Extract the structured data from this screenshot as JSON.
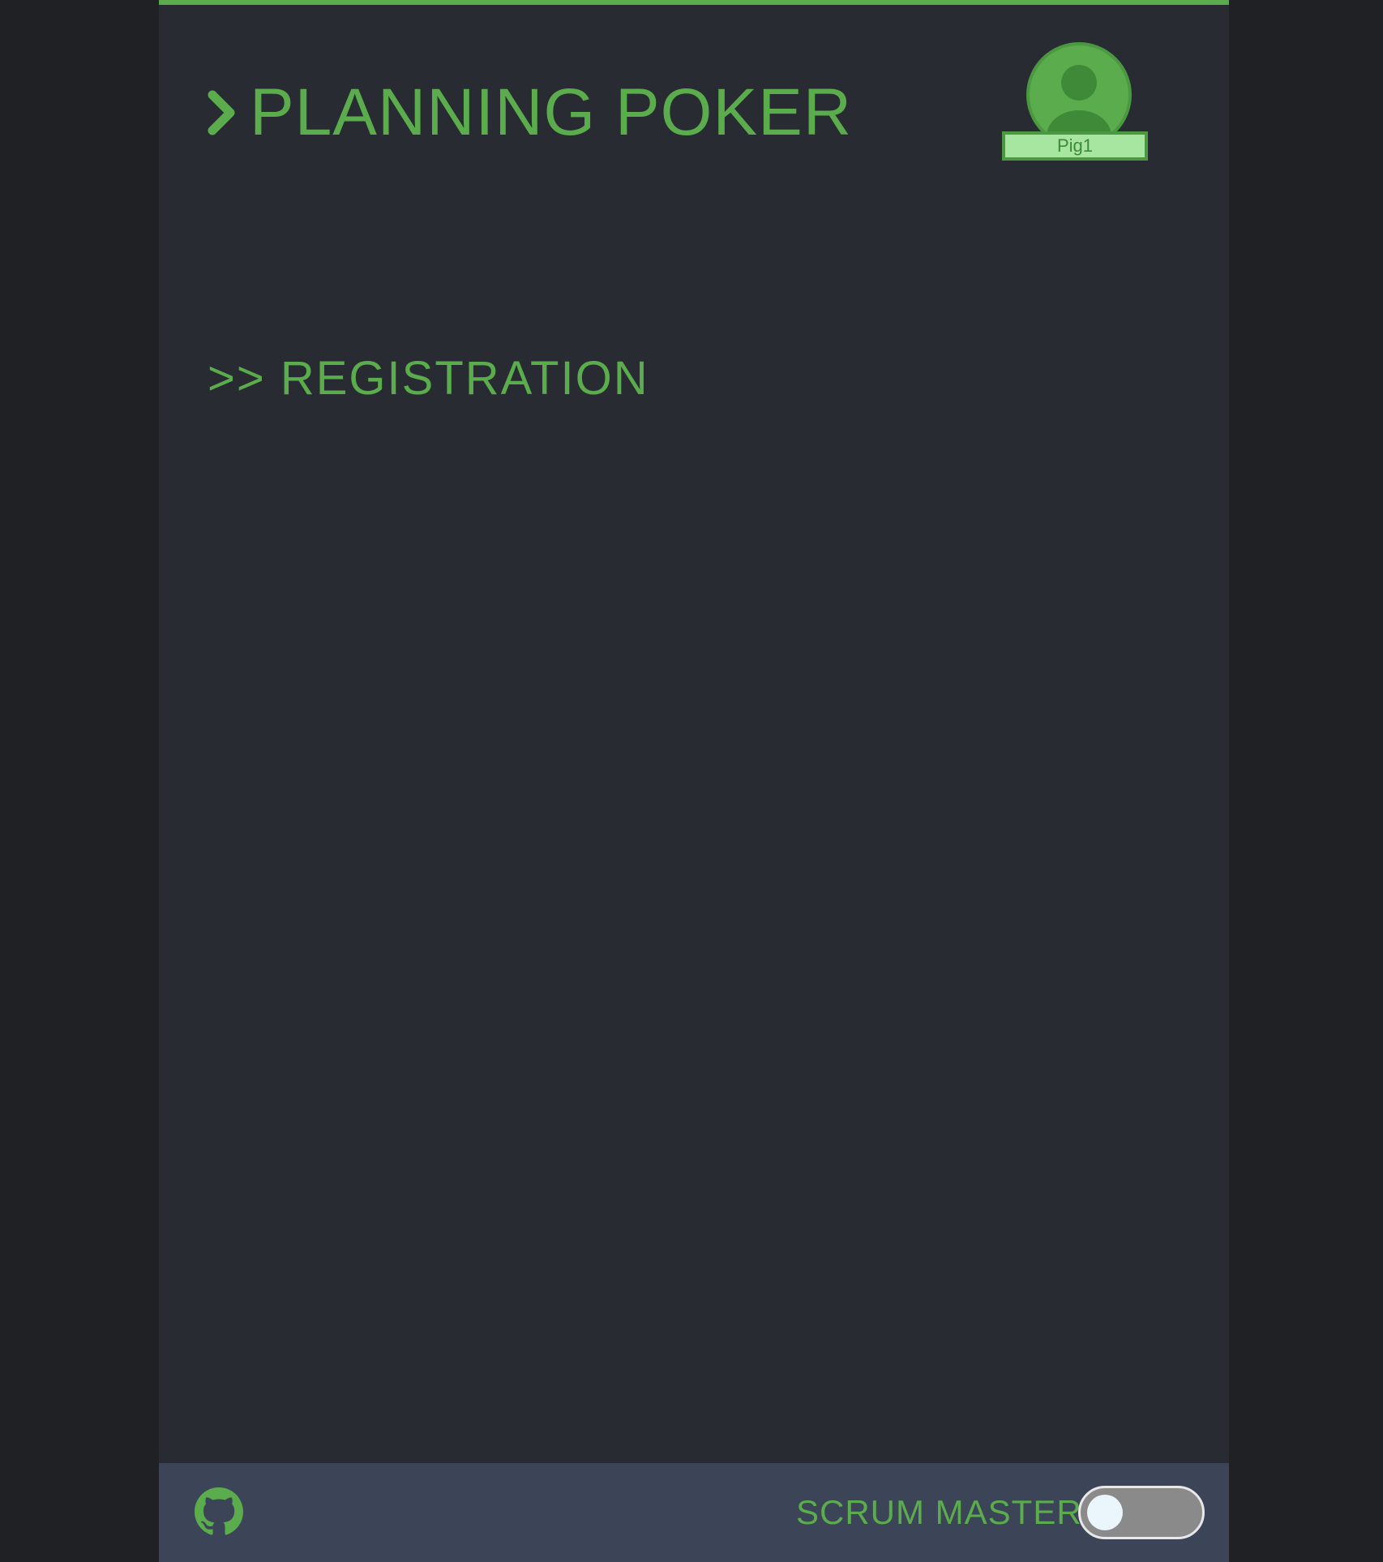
{
  "header": {
    "title": "PLANNING POKER"
  },
  "user": {
    "name": "Pig1"
  },
  "section": {
    "heading": ">> REGISTRATION"
  },
  "footer": {
    "scrum_master_label": "SCRUM MASTER",
    "scrum_master_enabled": false
  },
  "colors": {
    "accent": "#5aac4c",
    "background": "#282b31",
    "page_background": "#202125",
    "footer_background": "#3c4558",
    "avatar_name_background": "#a6e6a0"
  },
  "icons": [
    "chevron-right-icon",
    "user-icon",
    "github-icon"
  ]
}
